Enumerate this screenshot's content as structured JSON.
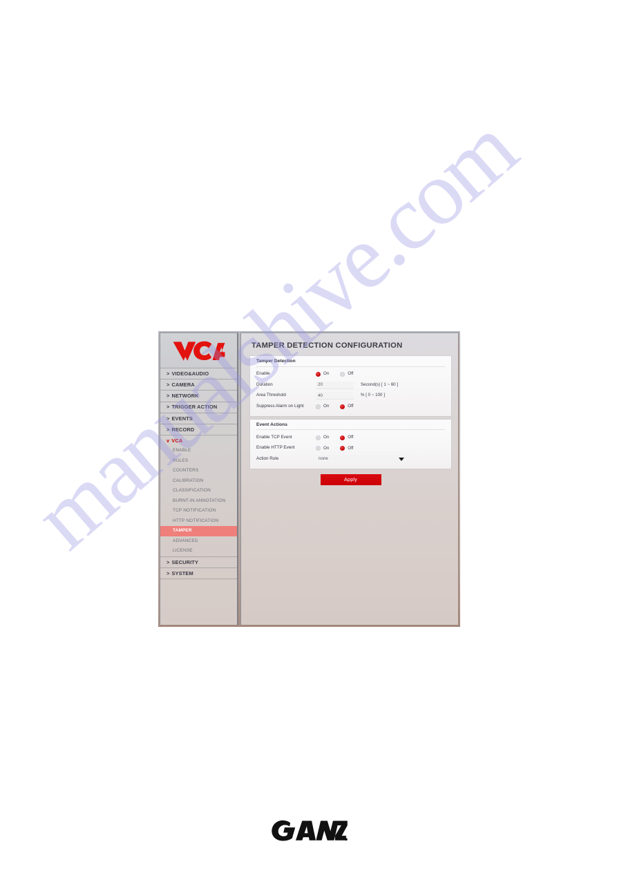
{
  "watermark": {
    "text": "manualshive.com"
  },
  "sidebar": {
    "logo_alt": "VCA",
    "top_items": [
      {
        "label": "VIDEO&AUDIO",
        "caret": ">",
        "open": false
      },
      {
        "label": "CAMERA",
        "caret": ">",
        "open": false
      },
      {
        "label": "NETWORK",
        "caret": ">",
        "open": false
      },
      {
        "label": "TRIGGER ACTION",
        "caret": ">",
        "open": false
      },
      {
        "label": "EVENTS",
        "caret": ">",
        "open": false
      },
      {
        "label": "RECORD",
        "caret": ">",
        "open": false
      },
      {
        "label": "VCA",
        "caret": "v",
        "open": true
      }
    ],
    "sub_items": [
      {
        "label": "ENABLE",
        "active": false
      },
      {
        "label": "RULES",
        "active": false
      },
      {
        "label": "COUNTERS",
        "active": false
      },
      {
        "label": "CALIBRATION",
        "active": false
      },
      {
        "label": "CLASSIFICATION",
        "active": false
      },
      {
        "label": "BURNT-IN ANNOTATION",
        "active": false
      },
      {
        "label": "TCP NOTIFICATION",
        "active": false
      },
      {
        "label": "HTTP NOTIFICATION",
        "active": false
      },
      {
        "label": "TAMPER",
        "active": true
      },
      {
        "label": "ADVANCED",
        "active": false
      },
      {
        "label": "LICENSE",
        "active": false
      }
    ],
    "bottom_items": [
      {
        "label": "SECURITY",
        "caret": ">",
        "open": false
      },
      {
        "label": "SYSTEM",
        "caret": ">",
        "open": false
      }
    ]
  },
  "main": {
    "title": "TAMPER DETECTION CONFIGURATION",
    "tamper_panel": {
      "title": "Tamper Detection",
      "enable": {
        "label": "Enable",
        "on_label": "On",
        "off_label": "Off",
        "selected": "On"
      },
      "duration": {
        "label": "Duration",
        "value": "20",
        "unit": "Second(s) [ 1 ~ 60 ]"
      },
      "area_threshold": {
        "label": "Area Threshold",
        "value": "40",
        "unit": "% [ 0 ~ 100 ]"
      },
      "suppress": {
        "label": "Suppress Alarm on Light",
        "on_label": "On",
        "off_label": "Off",
        "selected": "Off"
      }
    },
    "event_panel": {
      "title": "Event Actions",
      "tcp": {
        "label": "Enable TCP Event",
        "on_label": "On",
        "off_label": "Off",
        "selected": "Off"
      },
      "http": {
        "label": "Enable HTTP Event",
        "on_label": "On",
        "off_label": "Off",
        "selected": "Off"
      },
      "action_rule": {
        "label": "Action Rule",
        "value": "none"
      }
    },
    "apply_label": "Apply"
  },
  "footer": {
    "brand": "GANZ"
  },
  "colors": {
    "accent_red": "#cc0000",
    "active_row": "#ef7f7b",
    "watermark": "#9694e2"
  }
}
